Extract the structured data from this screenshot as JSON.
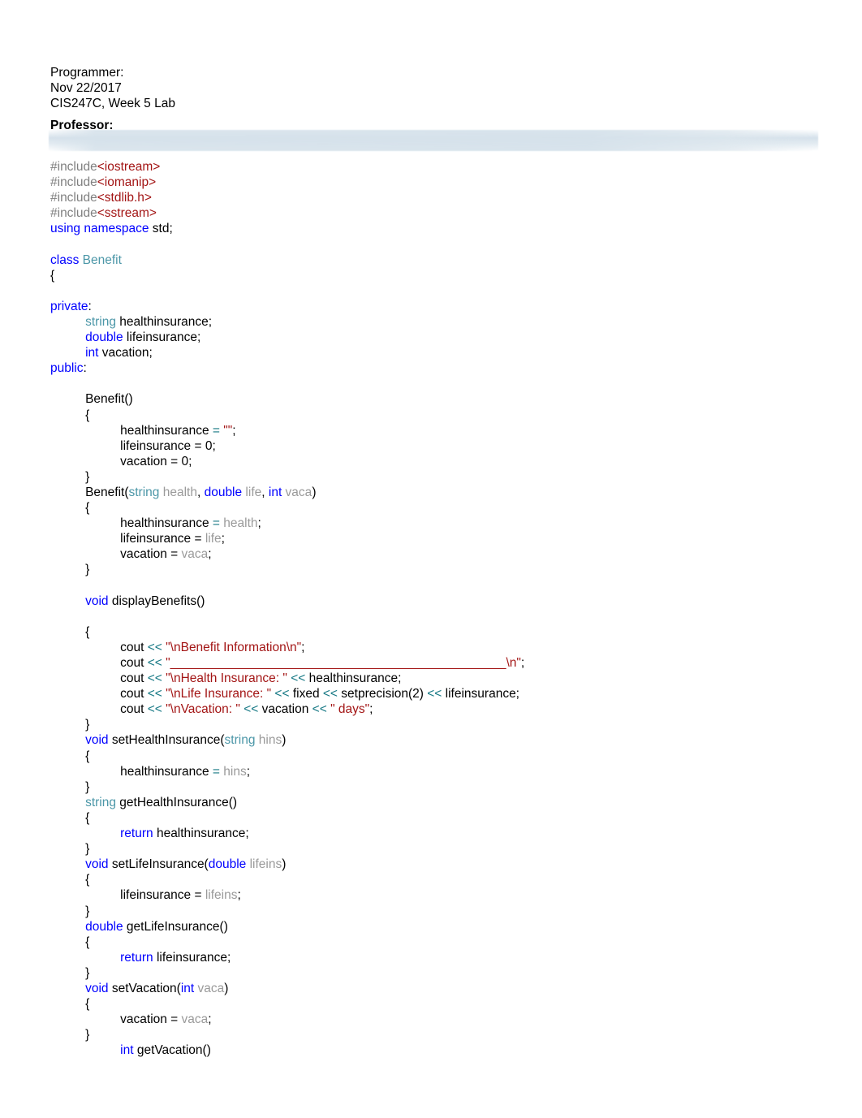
{
  "document": {
    "title": "CIS247C, Week 5 Lab",
    "page_background": "#ffffff"
  },
  "header": {
    "programmer_label": "Programmer:",
    "date": "Nov 22/2017",
    "course": "CIS247C, Week 5 Lab",
    "professor_label": "Professor:"
  },
  "colors": {
    "preprocessor": "#808080",
    "include_path": "#A31515",
    "keyword": "#0000FF",
    "type_name": "#4C97A8",
    "string_literal": "#A31515",
    "operator": "#197A86",
    "parameter": "#9A9A9A",
    "plain_text": "#000000",
    "rule_band": "#D6E2EB"
  },
  "code": {
    "language": "C++",
    "lines": [
      {
        "indent": 0,
        "tokens": [
          {
            "t": "pre",
            "v": "#include"
          },
          {
            "t": "inc",
            "v": "<iostream>"
          }
        ]
      },
      {
        "indent": 0,
        "tokens": [
          {
            "t": "pre",
            "v": "#include"
          },
          {
            "t": "inc",
            "v": "<iomanip>"
          }
        ]
      },
      {
        "indent": 0,
        "tokens": [
          {
            "t": "pre",
            "v": "#include"
          },
          {
            "t": "inc",
            "v": "<stdlib.h>"
          }
        ]
      },
      {
        "indent": 0,
        "tokens": [
          {
            "t": "pre",
            "v": "#include"
          },
          {
            "t": "inc",
            "v": "<sstream>"
          }
        ]
      },
      {
        "indent": 0,
        "tokens": [
          {
            "t": "kw",
            "v": "using namespace"
          },
          {
            "t": "plain",
            "v": " std;"
          }
        ]
      },
      {
        "indent": 0,
        "tokens": []
      },
      {
        "indent": 0,
        "tokens": [
          {
            "t": "kw",
            "v": "class"
          },
          {
            "t": "plain",
            "v": " "
          },
          {
            "t": "type",
            "v": "Benefit"
          }
        ]
      },
      {
        "indent": 0,
        "tokens": [
          {
            "t": "plain",
            "v": "{"
          }
        ]
      },
      {
        "indent": 0,
        "tokens": []
      },
      {
        "indent": 0,
        "tokens": [
          {
            "t": "kw",
            "v": "private"
          },
          {
            "t": "plain",
            "v": ":"
          }
        ]
      },
      {
        "indent": 1,
        "tokens": [
          {
            "t": "type",
            "v": "string"
          },
          {
            "t": "plain",
            "v": " healthinsurance;"
          }
        ]
      },
      {
        "indent": 1,
        "tokens": [
          {
            "t": "kw",
            "v": "double"
          },
          {
            "t": "plain",
            "v": " lifeinsurance;"
          }
        ]
      },
      {
        "indent": 1,
        "tokens": [
          {
            "t": "kw",
            "v": "int"
          },
          {
            "t": "plain",
            "v": " vacation;"
          }
        ]
      },
      {
        "indent": 0,
        "tokens": [
          {
            "t": "kw",
            "v": "public"
          },
          {
            "t": "plain",
            "v": ":"
          }
        ]
      },
      {
        "indent": 0,
        "tokens": []
      },
      {
        "indent": 1,
        "tokens": [
          {
            "t": "plain",
            "v": "Benefit()"
          }
        ]
      },
      {
        "indent": 1,
        "tokens": [
          {
            "t": "plain",
            "v": "{"
          }
        ]
      },
      {
        "indent": 2,
        "tokens": [
          {
            "t": "plain",
            "v": "healthinsurance "
          },
          {
            "t": "op",
            "v": "="
          },
          {
            "t": "plain",
            "v": " "
          },
          {
            "t": "str",
            "v": "\"\""
          },
          {
            "t": "plain",
            "v": ";"
          }
        ]
      },
      {
        "indent": 2,
        "tokens": [
          {
            "t": "plain",
            "v": "lifeinsurance = 0;"
          }
        ]
      },
      {
        "indent": 2,
        "tokens": [
          {
            "t": "plain",
            "v": "vacation = 0;"
          }
        ]
      },
      {
        "indent": 1,
        "tokens": [
          {
            "t": "plain",
            "v": "}"
          }
        ]
      },
      {
        "indent": 1,
        "tokens": [
          {
            "t": "plain",
            "v": "Benefit("
          },
          {
            "t": "type",
            "v": "string"
          },
          {
            "t": "param",
            "v": " health"
          },
          {
            "t": "plain",
            "v": ", "
          },
          {
            "t": "kw",
            "v": "double"
          },
          {
            "t": "param",
            "v": " life"
          },
          {
            "t": "plain",
            "v": ", "
          },
          {
            "t": "kw",
            "v": "int"
          },
          {
            "t": "param",
            "v": " vaca"
          },
          {
            "t": "plain",
            "v": ")"
          }
        ]
      },
      {
        "indent": 1,
        "tokens": [
          {
            "t": "plain",
            "v": "{"
          }
        ]
      },
      {
        "indent": 2,
        "tokens": [
          {
            "t": "plain",
            "v": "healthinsurance "
          },
          {
            "t": "op",
            "v": "="
          },
          {
            "t": "param",
            "v": " health"
          },
          {
            "t": "plain",
            "v": ";"
          }
        ]
      },
      {
        "indent": 2,
        "tokens": [
          {
            "t": "plain",
            "v": "lifeinsurance = "
          },
          {
            "t": "param",
            "v": "life"
          },
          {
            "t": "plain",
            "v": ";"
          }
        ]
      },
      {
        "indent": 2,
        "tokens": [
          {
            "t": "plain",
            "v": "vacation = "
          },
          {
            "t": "param",
            "v": "vaca"
          },
          {
            "t": "plain",
            "v": ";"
          }
        ]
      },
      {
        "indent": 1,
        "tokens": [
          {
            "t": "plain",
            "v": "}"
          }
        ]
      },
      {
        "indent": 0,
        "tokens": []
      },
      {
        "indent": 1,
        "tokens": [
          {
            "t": "kw",
            "v": "void"
          },
          {
            "t": "plain",
            "v": " displayBenefits()"
          }
        ]
      },
      {
        "indent": 0,
        "tokens": []
      },
      {
        "indent": 1,
        "tokens": [
          {
            "t": "plain",
            "v": "{"
          }
        ]
      },
      {
        "indent": 2,
        "tokens": [
          {
            "t": "plain",
            "v": "cout "
          },
          {
            "t": "op",
            "v": "<<"
          },
          {
            "t": "plain",
            "v": " "
          },
          {
            "t": "str",
            "v": "\"\\nBenefit Information\\n\""
          },
          {
            "t": "plain",
            "v": ";"
          }
        ]
      },
      {
        "indent": 2,
        "tokens": [
          {
            "t": "plain",
            "v": "cout "
          },
          {
            "t": "op",
            "v": "<<"
          },
          {
            "t": "plain",
            "v": " "
          },
          {
            "t": "str",
            "v": "\"________________________________________________\\n\""
          },
          {
            "t": "plain",
            "v": ";"
          }
        ]
      },
      {
        "indent": 2,
        "tokens": [
          {
            "t": "plain",
            "v": "cout "
          },
          {
            "t": "op",
            "v": "<<"
          },
          {
            "t": "plain",
            "v": " "
          },
          {
            "t": "str",
            "v": "\"\\nHealth Insurance: \""
          },
          {
            "t": "plain",
            "v": " "
          },
          {
            "t": "op",
            "v": "<<"
          },
          {
            "t": "plain",
            "v": " healthinsurance;"
          }
        ]
      },
      {
        "indent": 2,
        "tokens": [
          {
            "t": "plain",
            "v": "cout "
          },
          {
            "t": "op",
            "v": "<<"
          },
          {
            "t": "plain",
            "v": " "
          },
          {
            "t": "str",
            "v": "\"\\nLife Insurance: \""
          },
          {
            "t": "plain",
            "v": " "
          },
          {
            "t": "op",
            "v": "<<"
          },
          {
            "t": "plain",
            "v": " fixed "
          },
          {
            "t": "op",
            "v": "<<"
          },
          {
            "t": "plain",
            "v": " setprecision(2) "
          },
          {
            "t": "op",
            "v": "<<"
          },
          {
            "t": "plain",
            "v": " lifeinsurance;"
          }
        ]
      },
      {
        "indent": 2,
        "tokens": [
          {
            "t": "plain",
            "v": "cout "
          },
          {
            "t": "op",
            "v": "<<"
          },
          {
            "t": "plain",
            "v": " "
          },
          {
            "t": "str",
            "v": "\"\\nVacation: \""
          },
          {
            "t": "plain",
            "v": " "
          },
          {
            "t": "op",
            "v": "<<"
          },
          {
            "t": "plain",
            "v": " vacation "
          },
          {
            "t": "op",
            "v": "<<"
          },
          {
            "t": "plain",
            "v": " "
          },
          {
            "t": "str",
            "v": "\" days\""
          },
          {
            "t": "plain",
            "v": ";"
          }
        ]
      },
      {
        "indent": 1,
        "tokens": [
          {
            "t": "plain",
            "v": "}"
          }
        ]
      },
      {
        "indent": 1,
        "tokens": [
          {
            "t": "kw",
            "v": "void"
          },
          {
            "t": "plain",
            "v": " setHealthInsurance("
          },
          {
            "t": "type",
            "v": "string"
          },
          {
            "t": "param",
            "v": " hins"
          },
          {
            "t": "plain",
            "v": ")"
          }
        ]
      },
      {
        "indent": 1,
        "tokens": [
          {
            "t": "plain",
            "v": "{"
          }
        ]
      },
      {
        "indent": 2,
        "tokens": [
          {
            "t": "plain",
            "v": "healthinsurance "
          },
          {
            "t": "op",
            "v": "="
          },
          {
            "t": "param",
            "v": " hins"
          },
          {
            "t": "plain",
            "v": ";"
          }
        ]
      },
      {
        "indent": 1,
        "tokens": [
          {
            "t": "plain",
            "v": "}"
          }
        ]
      },
      {
        "indent": 1,
        "tokens": [
          {
            "t": "type",
            "v": "string"
          },
          {
            "t": "plain",
            "v": " getHealthInsurance()"
          }
        ]
      },
      {
        "indent": 1,
        "tokens": [
          {
            "t": "plain",
            "v": "{"
          }
        ]
      },
      {
        "indent": 2,
        "tokens": [
          {
            "t": "kw",
            "v": "return"
          },
          {
            "t": "plain",
            "v": " healthinsurance;"
          }
        ]
      },
      {
        "indent": 1,
        "tokens": [
          {
            "t": "plain",
            "v": "}"
          }
        ]
      },
      {
        "indent": 1,
        "tokens": [
          {
            "t": "kw",
            "v": "void"
          },
          {
            "t": "plain",
            "v": " setLifeInsurance("
          },
          {
            "t": "kw",
            "v": "double"
          },
          {
            "t": "param",
            "v": " lifeins"
          },
          {
            "t": "plain",
            "v": ")"
          }
        ]
      },
      {
        "indent": 1,
        "tokens": [
          {
            "t": "plain",
            "v": "{"
          }
        ]
      },
      {
        "indent": 2,
        "tokens": [
          {
            "t": "plain",
            "v": "lifeinsurance = "
          },
          {
            "t": "param",
            "v": "lifeins"
          },
          {
            "t": "plain",
            "v": ";"
          }
        ]
      },
      {
        "indent": 1,
        "tokens": [
          {
            "t": "plain",
            "v": "}"
          }
        ]
      },
      {
        "indent": 1,
        "tokens": [
          {
            "t": "kw",
            "v": "double"
          },
          {
            "t": "plain",
            "v": " getLifeInsurance()"
          }
        ]
      },
      {
        "indent": 1,
        "tokens": [
          {
            "t": "plain",
            "v": "{"
          }
        ]
      },
      {
        "indent": 2,
        "tokens": [
          {
            "t": "kw",
            "v": "return"
          },
          {
            "t": "plain",
            "v": " lifeinsurance;"
          }
        ]
      },
      {
        "indent": 1,
        "tokens": [
          {
            "t": "plain",
            "v": "}"
          }
        ]
      },
      {
        "indent": 1,
        "tokens": [
          {
            "t": "kw",
            "v": "void"
          },
          {
            "t": "plain",
            "v": " setVacation("
          },
          {
            "t": "kw",
            "v": "int"
          },
          {
            "t": "param",
            "v": " vaca"
          },
          {
            "t": "plain",
            "v": ")"
          }
        ]
      },
      {
        "indent": 1,
        "tokens": [
          {
            "t": "plain",
            "v": "{"
          }
        ]
      },
      {
        "indent": 2,
        "tokens": [
          {
            "t": "plain",
            "v": "vacation = "
          },
          {
            "t": "param",
            "v": "vaca"
          },
          {
            "t": "plain",
            "v": ";"
          }
        ]
      },
      {
        "indent": 1,
        "tokens": [
          {
            "t": "plain",
            "v": "}"
          }
        ]
      },
      {
        "indent": 2,
        "tokens": [
          {
            "t": "kw",
            "v": "int"
          },
          {
            "t": "plain",
            "v": " getVacation()"
          }
        ]
      }
    ]
  }
}
